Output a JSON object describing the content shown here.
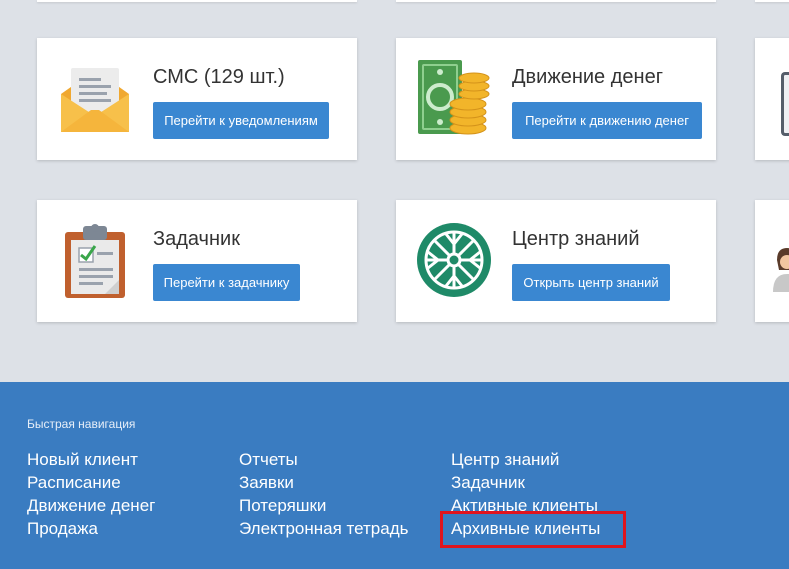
{
  "cards": [
    {
      "title": "СМС (129 шт.)",
      "button": "Перейти к уведомлениям",
      "icon": "envelope-icon"
    },
    {
      "title": "Движение денег",
      "button": "Перейти к движению денег",
      "icon": "money-coins-icon"
    },
    {
      "title": "Задачник",
      "button": "Перейти к задачнику",
      "icon": "clipboard-checklist-icon"
    },
    {
      "title": "Центр знаний",
      "button": "Открыть центр знаний",
      "icon": "knowledge-emblem-icon"
    }
  ],
  "footer": {
    "heading": "Быстрая навигация",
    "col1": [
      "Новый клиент",
      "Расписание",
      "Движение денег",
      "Продажа"
    ],
    "col2": [
      "Отчеты",
      "Заявки",
      "Потеряшки",
      "Электронная тетрадь"
    ],
    "col3": [
      "Центр знаний",
      "Задачник",
      "Активные клиенты",
      "Архивные клиенты"
    ]
  },
  "colors": {
    "accent_button": "#3a87d1",
    "footer_bg": "#3a7cc1",
    "page_bg": "#dde1e7",
    "highlight": "#e0141e"
  }
}
